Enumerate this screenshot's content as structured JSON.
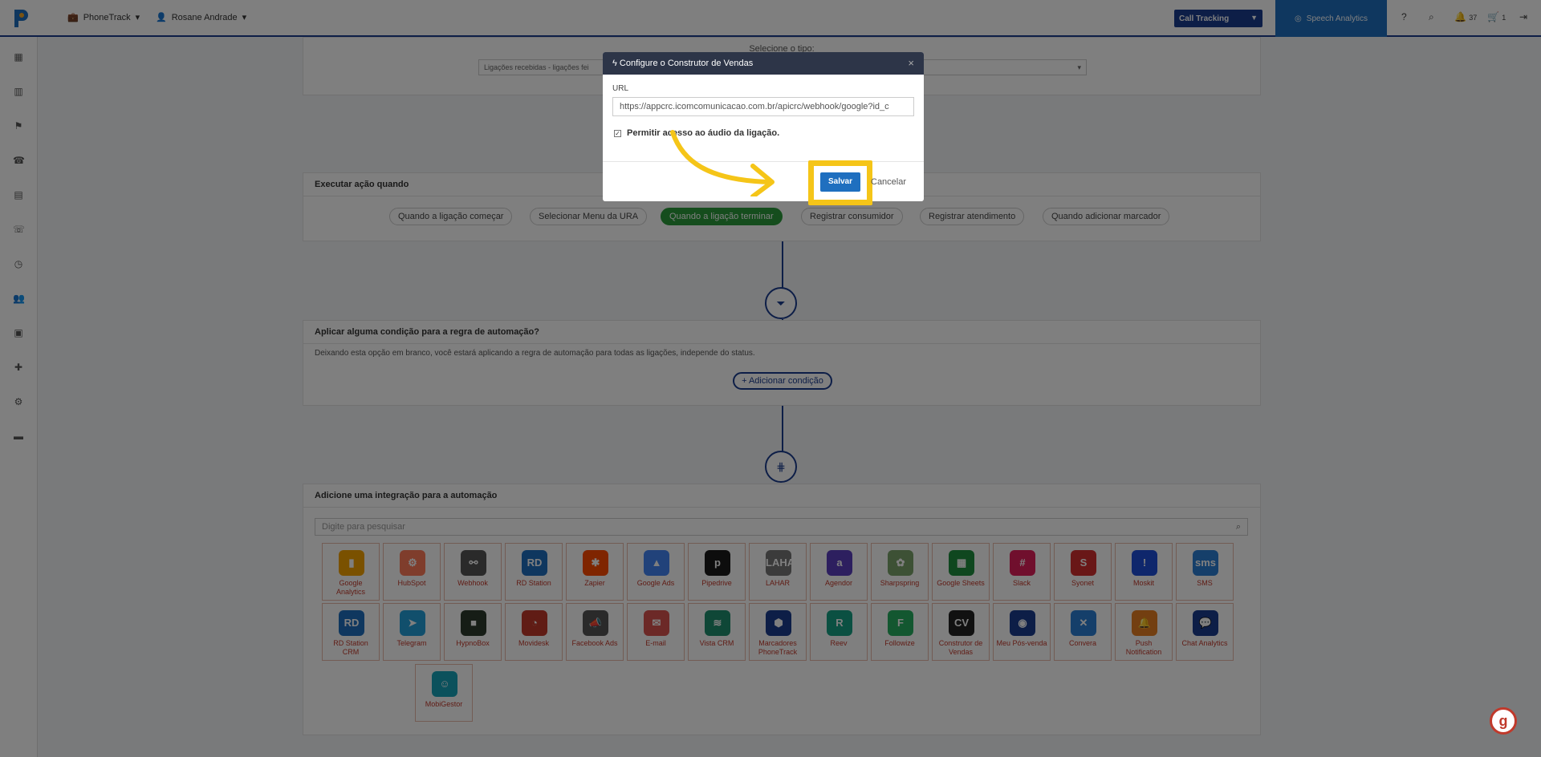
{
  "topbar": {
    "product": "PhoneTrack",
    "user": "Rosane Andrade",
    "call_tracking": "Call Tracking",
    "speech_analytics": "Speech Analytics",
    "notifications_count": "37",
    "cart_count": "1"
  },
  "type_section": {
    "label": "Selecione o tipo:",
    "select_value": "Ligações recebidas - ligações fei"
  },
  "action_section": {
    "title": "Executar ação quando",
    "pills": [
      "Quando a ligação começar",
      "Selecionar Menu da URA",
      "Quando a ligação terminar",
      "Registrar consumidor",
      "Registrar atendimento",
      "Quando adicionar marcador"
    ]
  },
  "condition_section": {
    "title": "Aplicar alguma condição para a regra de automação?",
    "description": "Deixando esta opção em branco, você estará aplicando a regra de automação para todas as ligações, independe do status.",
    "add_button": "Adicionar condição"
  },
  "integration_section": {
    "title": "Adicione uma integração para a automação",
    "search_placeholder": "Digite para pesquisar",
    "row1": [
      {
        "label": "Google Analytics",
        "icon_text": "▮",
        "color": "#f4a300"
      },
      {
        "label": "HubSpot",
        "icon_text": "⚙",
        "color": "#ff7a59"
      },
      {
        "label": "Webhook",
        "icon_text": "⚯",
        "color": "#555555"
      },
      {
        "label": "RD Station",
        "icon_text": "RD",
        "color": "#1f6fbf"
      },
      {
        "label": "Zapier",
        "icon_text": "✱",
        "color": "#ff4a00"
      },
      {
        "label": "Google Ads",
        "icon_text": "▲",
        "color": "#4285f4"
      },
      {
        "label": "Pipedrive",
        "icon_text": "p",
        "color": "#1a1a1a"
      },
      {
        "label": "LAHAR",
        "icon_text": "LAHAR",
        "color": "#777777"
      },
      {
        "label": "Agendor",
        "icon_text": "a",
        "color": "#5a3fbf"
      },
      {
        "label": "Sharpspring",
        "icon_text": "✿",
        "color": "#7aa36a"
      },
      {
        "label": "Google Sheets",
        "icon_text": "▦",
        "color": "#1e8e3e"
      },
      {
        "label": "Slack",
        "icon_text": "#",
        "color": "#e01e5a"
      },
      {
        "label": "Syonet",
        "icon_text": "S",
        "color": "#d32f2f"
      },
      {
        "label": "Moskit",
        "icon_text": "!",
        "color": "#1f4fd8"
      },
      {
        "label": "SMS",
        "icon_text": "sms",
        "color": "#2a7fd4"
      }
    ],
    "row2": [
      {
        "label": "RD Station CRM",
        "icon_text": "RD",
        "color": "#1f6fbf"
      },
      {
        "label": "Telegram",
        "icon_text": "➤",
        "color": "#229ed9"
      },
      {
        "label": "HypnoBox",
        "icon_text": "■",
        "color": "#2d3b2d"
      },
      {
        "label": "Movidesk",
        "icon_text": "◔",
        "color": "#c0392b"
      },
      {
        "label": "Facebook Ads",
        "icon_text": "📣",
        "color": "#555555"
      },
      {
        "label": "E-mail",
        "icon_text": "✉",
        "color": "#d9534f"
      },
      {
        "label": "Vista CRM",
        "icon_text": "≋",
        "color": "#1e8e6e"
      },
      {
        "label": "Marcadores PhoneTrack",
        "icon_text": "⬢",
        "color": "#1a3c8f"
      },
      {
        "label": "Reev",
        "icon_text": "R",
        "color": "#16a085"
      },
      {
        "label": "Followize",
        "icon_text": "F",
        "color": "#27ae60"
      },
      {
        "label": "Construtor de Vendas",
        "icon_text": "CV",
        "color": "#222222"
      },
      {
        "label": "Meu Pós-venda",
        "icon_text": "◉",
        "color": "#1a3c8f"
      },
      {
        "label": "Convera",
        "icon_text": "✕",
        "color": "#2a7fd4"
      },
      {
        "label": "Push Notification",
        "icon_text": "🔔",
        "color": "#e67e22"
      },
      {
        "label": "Chat Analytics",
        "icon_text": "💬",
        "color": "#1a3c8f"
      }
    ],
    "row3": [
      {
        "label": "MobiGestor",
        "icon_text": "☺",
        "color": "#17a2b8"
      }
    ]
  },
  "modal": {
    "title": "Configure o Construtor de Vendas",
    "url_label": "URL",
    "url_value": "https://appcrc.icomcomunicacao.com.br/apicrc/webhook/google?id_c",
    "checkbox_label": "Permitir acesso ao áudio da ligação.",
    "save": "Salvar",
    "cancel": "Cancelar"
  },
  "highlight_color": "#f5c518"
}
